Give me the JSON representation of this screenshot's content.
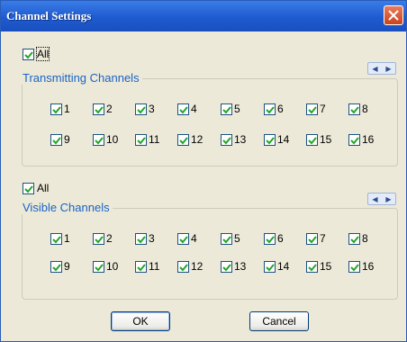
{
  "window": {
    "title": "Channel Settings"
  },
  "transmitting": {
    "all_label": "All",
    "group_label": "Transmitting Channels",
    "channels": [
      "1",
      "2",
      "3",
      "4",
      "5",
      "6",
      "7",
      "8",
      "9",
      "10",
      "11",
      "12",
      "13",
      "14",
      "15",
      "16"
    ]
  },
  "visible": {
    "all_label": "All",
    "group_label": "Visible Channels",
    "channels": [
      "1",
      "2",
      "3",
      "4",
      "5",
      "6",
      "7",
      "8",
      "9",
      "10",
      "11",
      "12",
      "13",
      "14",
      "15",
      "16"
    ]
  },
  "buttons": {
    "ok": "OK",
    "cancel": "Cancel"
  },
  "icons": {
    "close": "close-icon",
    "checkbox": "checkmark-icon",
    "spin": "spin-arrows-icon"
  },
  "colors": {
    "title_bar": "#1e5bd0",
    "close": "#c9431e",
    "group_label": "#1a63c6",
    "check": "#22a52a"
  }
}
